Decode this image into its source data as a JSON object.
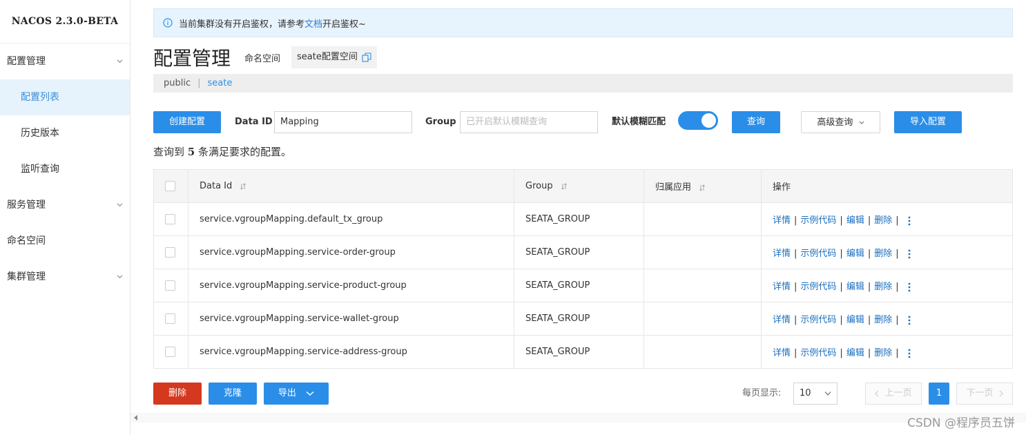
{
  "app": {
    "logo": "NACOS 2.3.0-BETA"
  },
  "sidebar": {
    "groups": [
      {
        "label": "配置管理",
        "expanded": true
      },
      {
        "label": "服务管理",
        "expanded": false
      },
      {
        "label": "命名空间"
      },
      {
        "label": "集群管理",
        "expanded": false
      }
    ],
    "config_items": [
      {
        "label": "配置列表",
        "active": true
      },
      {
        "label": "历史版本"
      },
      {
        "label": "监听查询"
      }
    ]
  },
  "alert": {
    "text_before": "当前集群没有开启鉴权，请参考",
    "link": "文档",
    "text_after": "开启鉴权~"
  },
  "header": {
    "title": "配置管理",
    "namespace_label": "命名空间",
    "namespace_value": "seate配置空间"
  },
  "namespace_bar": {
    "items": [
      "public",
      "seate"
    ],
    "separator": "|",
    "active": "seate"
  },
  "filters": {
    "create_label": "创建配置",
    "dataid_label": "Data ID",
    "dataid_value": "Mapping",
    "group_label": "Group",
    "group_placeholder": "已开启默认模糊查询",
    "fuzzy_label": "默认模糊匹配",
    "fuzzy_on": true,
    "query_label": "查询",
    "advanced_label": "高级查询",
    "import_label": "导入配置"
  },
  "result": {
    "prefix": "查询到",
    "count": "5",
    "suffix": "条满足要求的配置。"
  },
  "table": {
    "columns": [
      "Data Id",
      "Group",
      "归属应用",
      "操作"
    ],
    "actions": [
      "详情",
      "示例代码",
      "编辑",
      "删除"
    ],
    "rows": [
      {
        "data_id": "service.vgroupMapping.default_tx_group",
        "group": "SEATA_GROUP",
        "app": ""
      },
      {
        "data_id": "service.vgroupMapping.service-order-group",
        "group": "SEATA_GROUP",
        "app": ""
      },
      {
        "data_id": "service.vgroupMapping.service-product-group",
        "group": "SEATA_GROUP",
        "app": ""
      },
      {
        "data_id": "service.vgroupMapping.service-wallet-group",
        "group": "SEATA_GROUP",
        "app": ""
      },
      {
        "data_id": "service.vgroupMapping.service-address-group",
        "group": "SEATA_GROUP",
        "app": ""
      }
    ]
  },
  "bottom": {
    "delete_label": "删除",
    "clone_label": "克隆",
    "export_label": "导出",
    "page_size_label": "每页显示:",
    "page_size": "10",
    "prev_label": "上一页",
    "current_page": "1",
    "next_label": "下一页"
  },
  "watermark": "CSDN @程序员五饼",
  "colors": {
    "primary": "#2a8ee8",
    "danger": "#d4381e",
    "link": "#1a6fbf",
    "active_bg": "#e6f3fc"
  }
}
